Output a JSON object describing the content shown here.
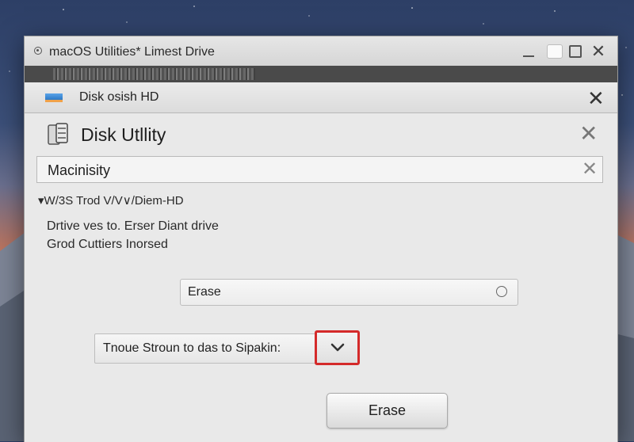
{
  "window": {
    "title": "macOS Utilities* Limest Drive"
  },
  "tab": {
    "label": "Disk osish HD"
  },
  "app": {
    "title": "Disk Utllity"
  },
  "drive_field": {
    "value": "Macinisity"
  },
  "volume": {
    "label": "W/3S Trod V/V∨/Diem-HD"
  },
  "description": {
    "line1": "Drtive ves to. Erser Diant drive",
    "line2": "Grod Cuttiers Inorsed"
  },
  "erase_field": {
    "label": "Erase"
  },
  "format_select": {
    "value": "Tnoue Stroun to das to Sipakin:"
  },
  "buttons": {
    "erase": "Erase"
  },
  "colors": {
    "highlight": "#d42a2a",
    "window_bg": "#e9e9e9"
  }
}
